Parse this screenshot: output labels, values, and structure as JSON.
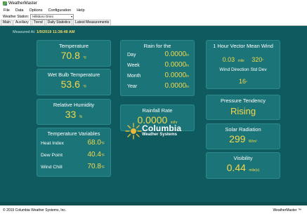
{
  "window": {
    "title": "WeatherMaster"
  },
  "menu": [
    "File",
    "Data",
    "Options",
    "Configuration",
    "Help"
  ],
  "station": {
    "label": "Weather Station:",
    "selected": "Hillsboro Omni"
  },
  "tabs": [
    "Main",
    "Auxiliary",
    "Trend",
    "Daily Statistics",
    "Latest Measurements"
  ],
  "measured": {
    "label": "Measured At:",
    "timestamp": "1/9/2019 11:38:48 AM"
  },
  "temperature": {
    "title": "Temperature",
    "value": "70.8",
    "unit": "°F"
  },
  "wet_bulb": {
    "title": "Wet Bulb Temperature",
    "value": "53.6",
    "unit": "°F"
  },
  "humidity": {
    "title": "Relative Humidity",
    "value": "33",
    "unit": "%"
  },
  "temp_vars": {
    "title": "Temperature Variables",
    "rows": [
      {
        "label": "Heat Index",
        "value": "68.0",
        "unit": "°F"
      },
      {
        "label": "Dew Point",
        "value": "40.4",
        "unit": "°F"
      },
      {
        "label": "Wind Chill",
        "value": "70.8",
        "unit": "°F"
      }
    ]
  },
  "rain": {
    "title": "Rain for the",
    "rows": [
      {
        "label": "Day",
        "value": "0.0000",
        "unit": "in"
      },
      {
        "label": "Week",
        "value": "0.0000",
        "unit": "in"
      },
      {
        "label": "Month",
        "value": "0.0000",
        "unit": "in"
      },
      {
        "label": "Year",
        "value": "0.0000",
        "unit": "in"
      }
    ]
  },
  "rain_rate": {
    "title": "Rainfall Rate",
    "value": "0.0000",
    "unit": "in/hr"
  },
  "logo": {
    "word": "Columbia",
    "sub": "Weather Systems"
  },
  "wind": {
    "title": "1 Hour Vector Mean Wind",
    "speed": "0.03",
    "speed_unit": "mile",
    "direction": "320",
    "direction_unit": "°",
    "std_title": "Wind Direction Std Dev",
    "std_value": "16",
    "std_unit": "°"
  },
  "pressure": {
    "title": "Pressure Tendency",
    "value": "Rising"
  },
  "solar": {
    "title": "Solar Radiation",
    "value": "299",
    "unit": "W/m²"
  },
  "visibility": {
    "title": "Visibility",
    "value": "0.44",
    "unit": "mile(s)"
  },
  "footer": {
    "copyright": "© 2019 Columbia Weather Systems, Inc.",
    "brand": "WeatherMaster ™"
  },
  "colors": {
    "background": "#0e5a5e",
    "panel": "#1b7477",
    "value": "#f5d94a"
  }
}
